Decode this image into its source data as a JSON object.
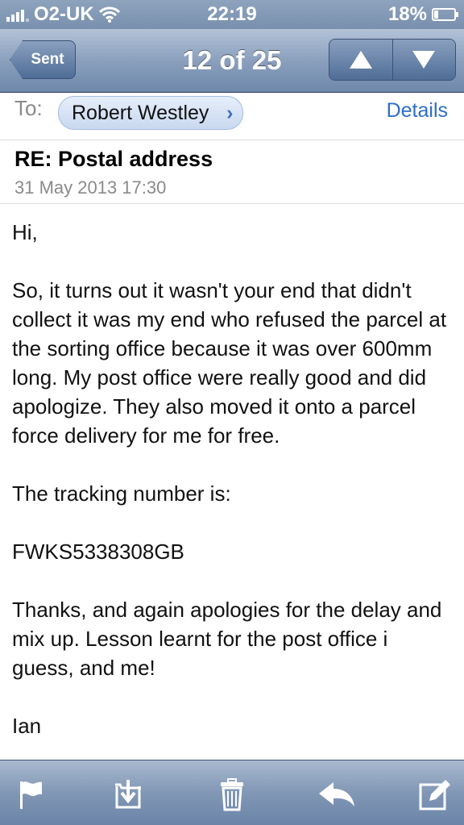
{
  "status_bar": {
    "carrier": "O2-UK",
    "time": "22:19",
    "battery": "18%"
  },
  "nav": {
    "back_label": "Sent",
    "title": "12 of 25"
  },
  "header": {
    "to_label": "To:",
    "recipient": "Robert Westley",
    "details_label": "Details",
    "subject": "RE: Postal address",
    "date": "31 May 2013 17:30"
  },
  "message": {
    "paragraphs": [
      "Hi,",
      "So, it turns out it wasn't your end that didn't collect it was my end who refused the parcel at the sorting office because it was over 600mm long. My post office were really good and did apologize. They also moved it onto a parcel force delivery for me for free.",
      "The tracking number is:",
      "FWKS5338308GB",
      "Thanks, and again apologies for the delay and mix up. Lesson learnt for the post office i guess, and me!",
      "Ian"
    ]
  },
  "toolbar": {
    "icons": [
      "flag-icon",
      "move-to-folder-icon",
      "trash-icon",
      "reply-icon",
      "compose-icon"
    ]
  }
}
